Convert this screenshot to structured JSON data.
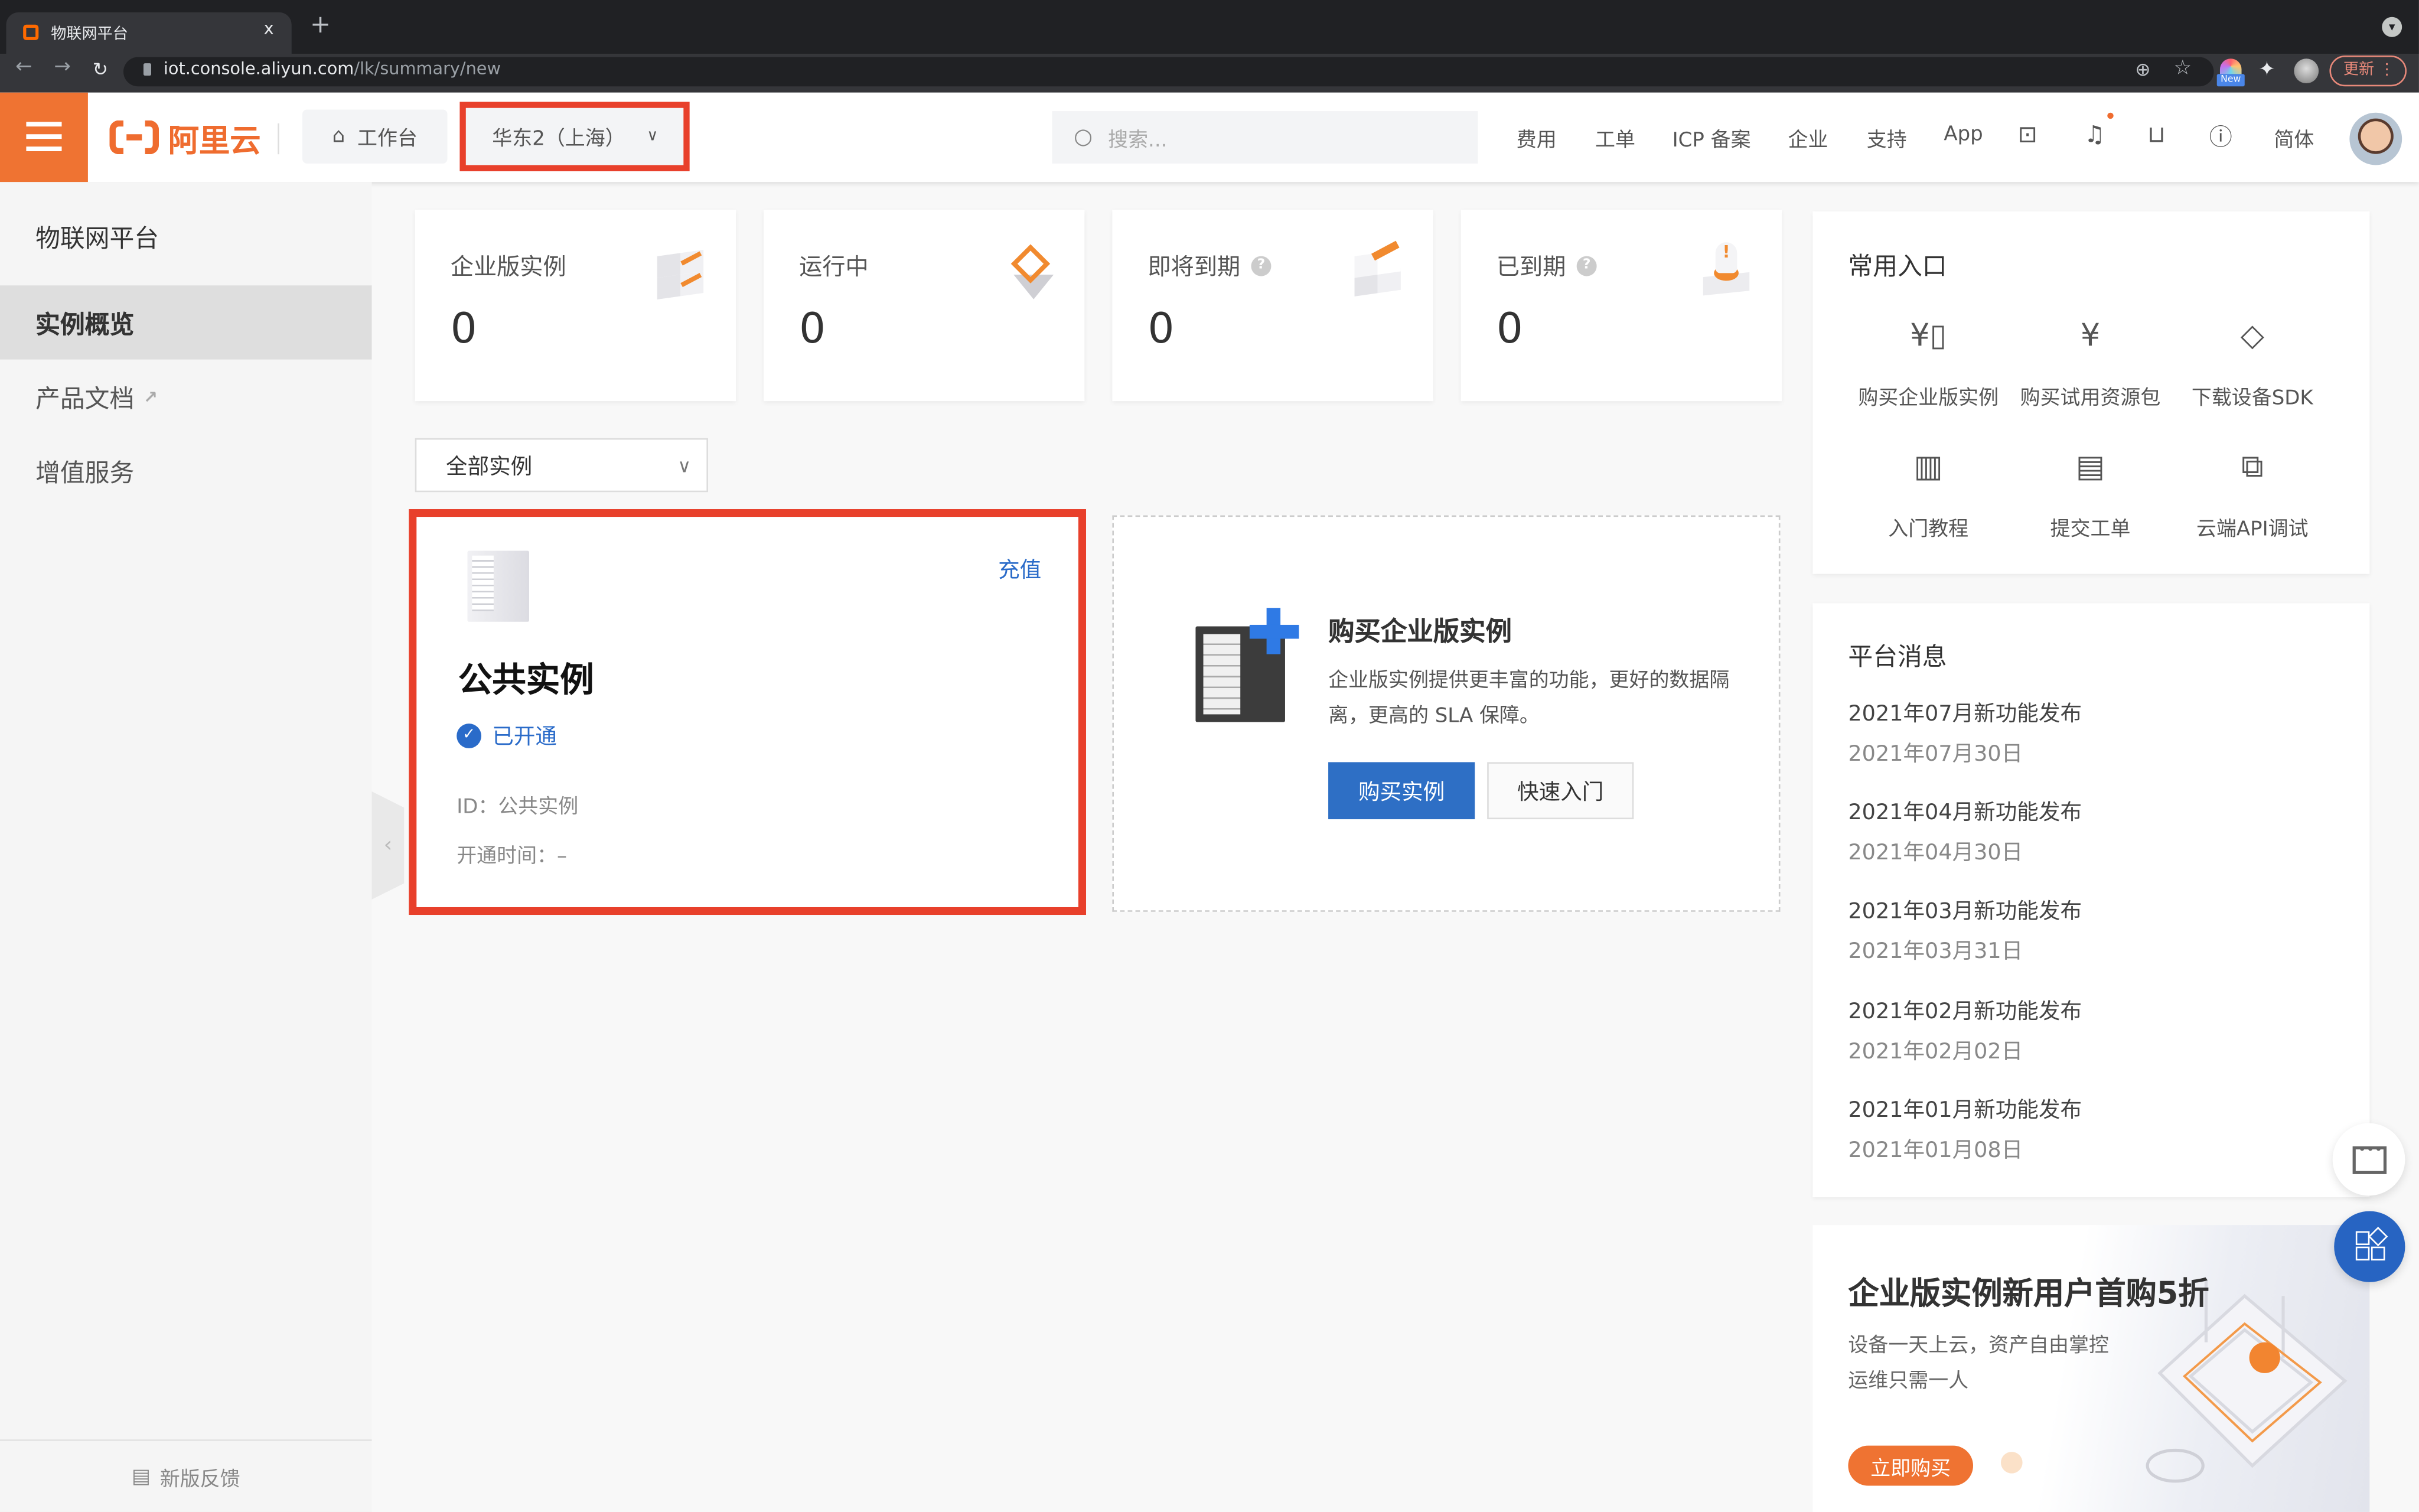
{
  "browser": {
    "tab_title": "物联网平台",
    "tab_close": "x",
    "new_tab": "+",
    "url_host": "iot.console.aliyun.com",
    "url_path": "/lk/summary/new",
    "ext_badge": "New",
    "update_label": "更新",
    "nav": {
      "back": "←",
      "forward": "→",
      "reload": "C"
    }
  },
  "header": {
    "brand": "阿里云",
    "workbench": "工作台",
    "region": "华东2（上海）",
    "search_placeholder": "搜索...",
    "nav": [
      "费用",
      "工单",
      "ICP 备案",
      "企业",
      "支持",
      "App"
    ],
    "language": "简体",
    "icons": [
      "terminal-icon",
      "bell-icon",
      "cart-icon",
      "help-icon"
    ]
  },
  "sidebar": {
    "title": "物联网平台",
    "items": [
      {
        "label": "实例概览",
        "active": true
      },
      {
        "label": "产品文档",
        "external": true
      },
      {
        "label": "增值服务"
      }
    ],
    "feedback": "新版反馈"
  },
  "stats": [
    {
      "label": "企业版实例",
      "value": "0",
      "help": false
    },
    {
      "label": "运行中",
      "value": "0",
      "help": false
    },
    {
      "label": "即将到期",
      "value": "0",
      "help": true
    },
    {
      "label": "已到期",
      "value": "0",
      "help": true
    }
  ],
  "filter": {
    "selected": "全部实例"
  },
  "public_instance": {
    "title": "公共实例",
    "recharge": "充值",
    "status": "已开通",
    "id_label": "ID：公共实例",
    "time_label": "开通时间：–"
  },
  "buy_card": {
    "title": "购买企业版实例",
    "desc": "企业版实例提供更丰富的功能，更好的数据隔离，更高的 SLA 保障。",
    "primary": "购买实例",
    "secondary": "快速入门"
  },
  "entries": {
    "title": "常用入口",
    "items": [
      {
        "label": "购买企业版实例",
        "icon": "building-yen-icon"
      },
      {
        "label": "购买试用资源包",
        "icon": "receipt-yen-icon"
      },
      {
        "label": "下载设备SDK",
        "icon": "layers-download-icon"
      },
      {
        "label": "入门教程",
        "icon": "book-icon"
      },
      {
        "label": "提交工单",
        "icon": "ticket-message-icon"
      },
      {
        "label": "云端API调试",
        "icon": "api-debug-icon"
      }
    ]
  },
  "messages": {
    "title": "平台消息",
    "items": [
      {
        "title": "2021年07月新功能发布",
        "date": "2021年07月30日"
      },
      {
        "title": "2021年04月新功能发布",
        "date": "2021年04月30日"
      },
      {
        "title": "2021年03月新功能发布",
        "date": "2021年03月31日"
      },
      {
        "title": "2021年02月新功能发布",
        "date": "2021年02月02日"
      },
      {
        "title": "2021年01月新功能发布",
        "date": "2021年01月08日"
      }
    ]
  },
  "promo": {
    "title": "企业版实例新用户首购5折",
    "line1": "设备一天上云，资产自由掌控",
    "line2": "运维只需一人",
    "button": "立即购买"
  },
  "colors": {
    "brand_orange": "#ef7332",
    "primary_blue": "#2e6fc5",
    "highlight_red": "#e8402b"
  }
}
